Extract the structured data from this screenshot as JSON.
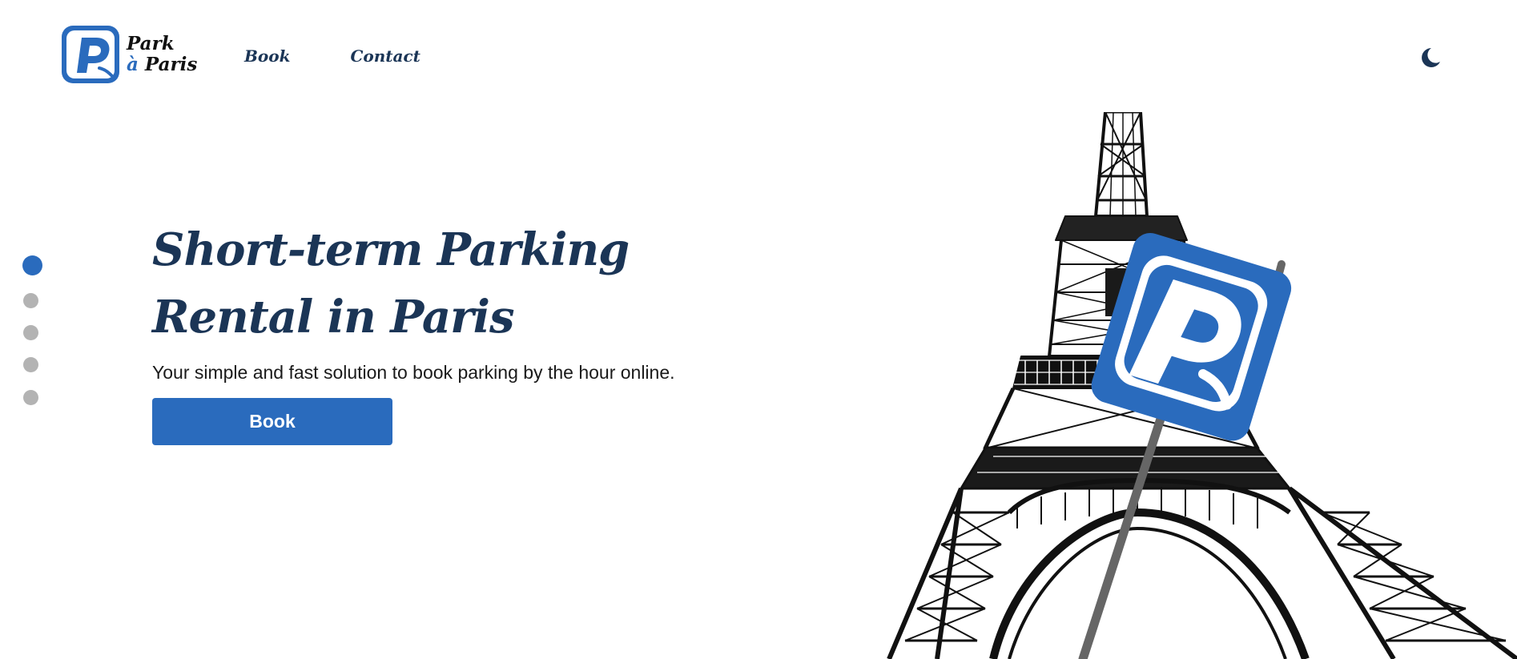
{
  "brand": {
    "logo_letter": "P",
    "name_line1": "Park",
    "name_line2_prefix": "à",
    "name_line2": "Paris",
    "primary_color": "#2a6bbd",
    "text_color": "#1b3556"
  },
  "nav": {
    "items": [
      {
        "label": "Book"
      },
      {
        "label": "Contact"
      }
    ]
  },
  "theme_toggle": {
    "icon": "moon-icon"
  },
  "slider": {
    "dot_count": 5,
    "active_index": 0
  },
  "hero": {
    "title": "Short-term Parking Rental in Paris",
    "subtitle": "Your simple and fast solution to book parking by the hour online.",
    "cta_label": "Book"
  },
  "illustration": {
    "subject": "eiffel-tower-sketch",
    "sign_icon": "parking-sign-icon"
  }
}
